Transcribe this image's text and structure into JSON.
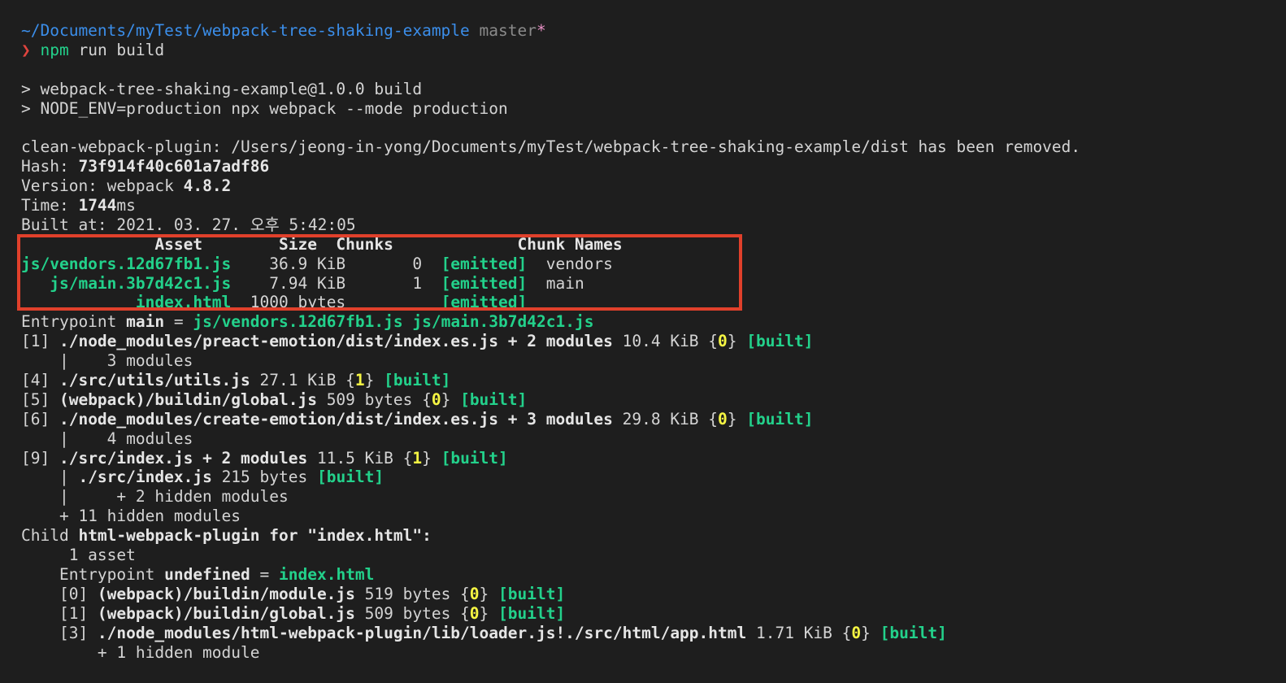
{
  "prompt": {
    "path": "~/Documents/myTest/webpack-tree-shaking-example",
    "branch": "master",
    "dirty": "*",
    "symbol": "❯",
    "cmd": "npm",
    "args": " run build"
  },
  "script": {
    "line1": "> webpack-tree-shaking-example@1.0.0 build",
    "line2": "> NODE_ENV=production npx webpack --mode production"
  },
  "clean": "clean-webpack-plugin: /Users/jeong-in-yong/Documents/myTest/webpack-tree-shaking-example/dist has been removed.",
  "meta": {
    "hash_label": "Hash: ",
    "hash": "73f914f40c601a7adf86",
    "version_label": "Version: webpack ",
    "version": "4.8.2",
    "time_label": "Time: ",
    "time": "1744",
    "time_unit": "ms",
    "built_at": "Built at: 2021. 03. 27. 오후 5:42:05"
  },
  "assets": {
    "header": "              Asset        Size  Chunks             Chunk Names",
    "rows": [
      {
        "pad": "",
        "name": "js/vendors.12d67fb1.js",
        "mid": "    36.9 KiB       0  ",
        "status": "[emitted]",
        "chunk": "  vendors"
      },
      {
        "pad": "   ",
        "name": "js/main.3b7d42c1.js",
        "mid": "    7.94 KiB       1  ",
        "status": "[emitted]",
        "chunk": "  main"
      },
      {
        "pad": "            ",
        "name": "index.html",
        "mid": "  1000 bytes          ",
        "status": "[emitted]",
        "chunk": ""
      }
    ]
  },
  "entrypoint": {
    "label": "Entrypoint ",
    "name": "main",
    "eq": " = ",
    "file1": "js/vendors.12d67fb1.js",
    "file2": "js/main.3b7d42c1.js"
  },
  "modules": {
    "m1_id": "[1] ",
    "m1_path": "./node_modules/preact-emotion/dist/index.es.js + 2 modules",
    "m1_size": " 10.4 KiB {",
    "m1_chunk": "0",
    "m1_sub": "    |    3 modules",
    "m4_id": "[4] ",
    "m4_path": "./src/utils/utils.js",
    "m4_size": " 27.1 KiB {",
    "m4_chunk": "1",
    "m5_id": "[5] ",
    "m5_path": "(webpack)/buildin/global.js",
    "m5_size": " 509 bytes {",
    "m5_chunk": "0",
    "m6_id": "[6] ",
    "m6_path": "./node_modules/create-emotion/dist/index.es.js + 3 modules",
    "m6_size": " 29.8 KiB {",
    "m6_chunk": "0",
    "m6_sub": "    |    4 modules",
    "m9_id": "[9] ",
    "m9_path": "./src/index.js + 2 modules",
    "m9_size": " 11.5 KiB {",
    "m9_chunk": "1",
    "m9_sub1_pre": "    | ",
    "m9_sub1_path": "./src/index.js",
    "m9_sub1_size": " 215 bytes ",
    "m9_sub2": "    |     + 2 hidden modules",
    "hidden": "    + 11 hidden modules",
    "built": "[built]",
    "close": "} "
  },
  "child": {
    "label": "Child ",
    "name": "html-webpack-plugin",
    "for": " for \"index.html\":",
    "asset": "     1 asset",
    "entry_pre": "    Entrypoint ",
    "entry_name": "undefined",
    "entry_eq": " = ",
    "entry_file": "index.html",
    "c0_id": "    [0] ",
    "c0_path": "(webpack)/buildin/module.js",
    "c0_size": " 519 bytes {",
    "c0_chunk": "0",
    "c1_id": "    [1] ",
    "c1_path": "(webpack)/buildin/global.js",
    "c1_size": " 509 bytes {",
    "c1_chunk": "0",
    "c3_id": "    [3] ",
    "c3_path": "./node_modules/html-webpack-plugin/lib/loader.js!./src/html/app.html",
    "c3_size": " 1.71 KiB {",
    "c3_chunk": "0",
    "hidden": "        + 1 hidden module"
  }
}
